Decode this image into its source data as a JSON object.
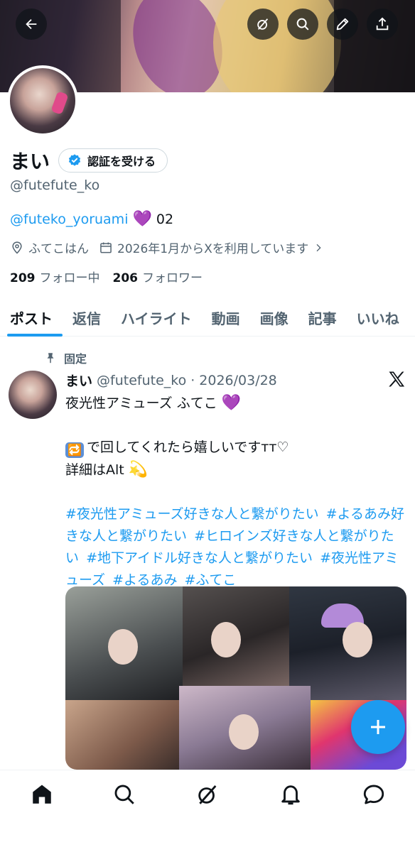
{
  "profile": {
    "name": "まい",
    "verify_label": "認証を受ける",
    "handle": "@futefute_ko",
    "bio_mention": "@futeko_yoruami",
    "bio_emoji": "💜",
    "bio_suffix": "02",
    "location": "ふてこはん",
    "joined": "2026年1月からXを利用しています",
    "following_count": "209",
    "following_label": "フォロー中",
    "followers_count": "206",
    "followers_label": "フォロワー"
  },
  "tabs": [
    "ポスト",
    "返信",
    "ハイライト",
    "動画",
    "画像",
    "記事",
    "いいね"
  ],
  "post": {
    "pinned_label": "固定",
    "author_name": "まい",
    "author_handle": "@futefute_ko",
    "dot": "·",
    "date": "2026/03/28",
    "line1": "夜光性アミューズ ふてこ",
    "line1_emoji": "💜",
    "line2": "で回してくれたら嬉しいですтт♡",
    "line2_emoji": "🔁",
    "line3": "詳細はAlt",
    "line3_emoji": "💫",
    "hashtags": [
      "#夜光性アミューズ好きな人と繋がりたい",
      "#よるあみ好きな人と繋がりたい",
      "#ヒロインズ好きな人と繋がりたい",
      "#地下アイドル好きな人と繋がりたい",
      "#夜光性アミューズ",
      "#よるあみ",
      "#ふてこ"
    ]
  },
  "colors": {
    "accent": "#1d9bf0",
    "secondary_text": "#536471",
    "primary_text": "#0f1419"
  }
}
